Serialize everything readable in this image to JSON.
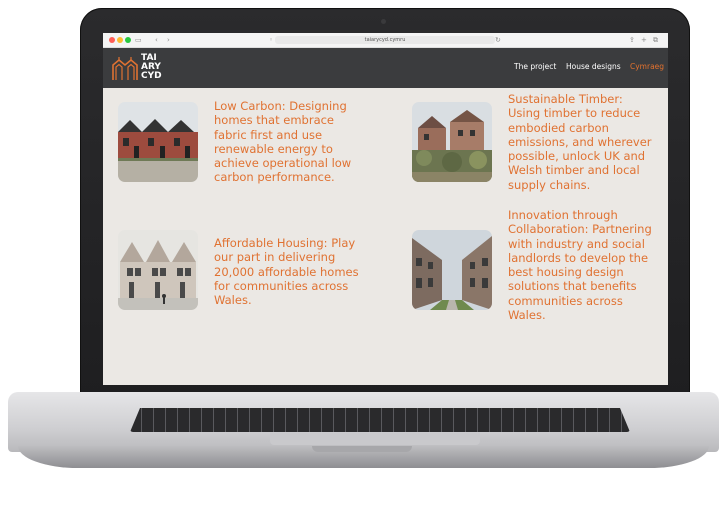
{
  "browser": {
    "url": "taiarycyd.cymru"
  },
  "site": {
    "logo": {
      "line1": "TAI",
      "line2": "ARY",
      "line3": "CYD"
    },
    "nav": [
      {
        "label": "The project"
      },
      {
        "label": "House designs"
      },
      {
        "label": "Cymraeg"
      }
    ]
  },
  "features": [
    {
      "text": "Low Carbon: Designing homes that embrace fabric first and use renewable energy to achieve operational low carbon performance."
    },
    {
      "text": "Sustainable Timber: Using timber to reduce embodied carbon emissions, and wherever possible, unlock UK and Welsh timber and local supply chains."
    },
    {
      "text": "Affordable Housing: Play our part in delivering 20,000 affordable homes for communities across Wales."
    },
    {
      "text": "Innovation through Collaboration: Partnering with industry and social landlords to develop the best housing design solutions that benefits communities across Wales."
    }
  ],
  "colors": {
    "accent": "#e07232",
    "nav_bg": "#3b3c3e",
    "page_bg": "#ebe8e4"
  }
}
